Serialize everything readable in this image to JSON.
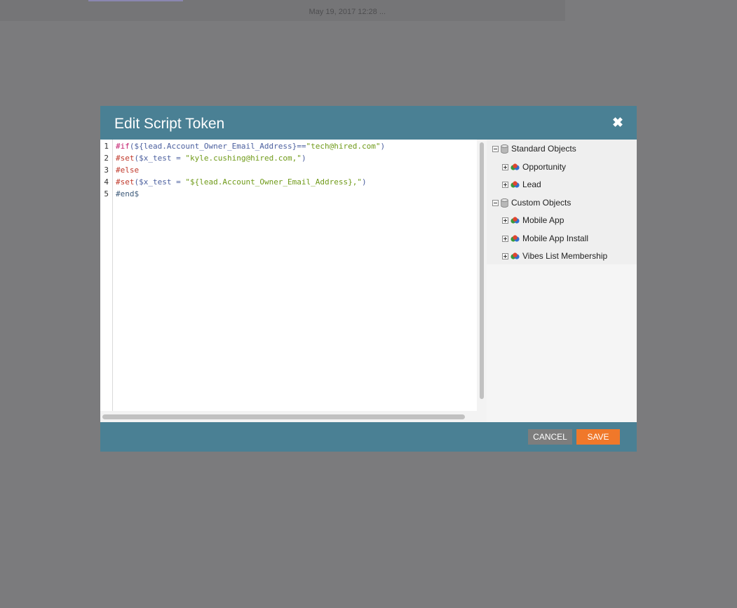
{
  "background": {
    "timestamp": "May 19, 2017 12:28 ..."
  },
  "dialog": {
    "title": "Edit Script Token",
    "close_icon": "close-icon",
    "cancel_label": "CANCEL",
    "save_label": "SAVE",
    "colors": {
      "header": "#4a8094",
      "save": "#f0782a",
      "cancel": "#7d7d7d"
    }
  },
  "editor": {
    "line_numbers": [
      "1",
      "2",
      "3",
      "4",
      "5"
    ],
    "lines": [
      [
        {
          "t": "#if",
          "c": "c-kw"
        },
        {
          "t": "(",
          "c": "c-op"
        },
        {
          "t": "${lead.Account_Owner_Email_Address}",
          "c": "c-var"
        },
        {
          "t": "==",
          "c": "c-op"
        },
        {
          "t": "\"tech@hired.com\"",
          "c": "c-str"
        },
        {
          "t": ")",
          "c": "c-op"
        }
      ],
      [
        {
          "t": "#set",
          "c": "c-dir"
        },
        {
          "t": "(",
          "c": "c-op"
        },
        {
          "t": "$x_test",
          "c": "c-var"
        },
        {
          "t": " = ",
          "c": "c-op"
        },
        {
          "t": "\"kyle.cushing@hired.com,\"",
          "c": "c-str"
        },
        {
          "t": ")",
          "c": "c-op"
        }
      ],
      [
        {
          "t": "#else",
          "c": "c-dir"
        }
      ],
      [
        {
          "t": "#set",
          "c": "c-dir"
        },
        {
          "t": "(",
          "c": "c-op"
        },
        {
          "t": "$x_test",
          "c": "c-var"
        },
        {
          "t": " = ",
          "c": "c-op"
        },
        {
          "t": "\"${lead.Account_Owner_Email_Address},\"",
          "c": "c-str"
        },
        {
          "t": ")",
          "c": "c-op"
        }
      ],
      [
        {
          "t": "#end$",
          "c": "c-end"
        }
      ]
    ]
  },
  "tree": {
    "groups": [
      {
        "label": "Standard Objects",
        "icon": "database-icon",
        "items": [
          "Opportunity",
          "Lead"
        ]
      },
      {
        "label": "Custom Objects",
        "icon": "database-icon",
        "items": [
          "Mobile App",
          "Mobile App Install",
          "Vibes List Membership"
        ]
      }
    ]
  }
}
